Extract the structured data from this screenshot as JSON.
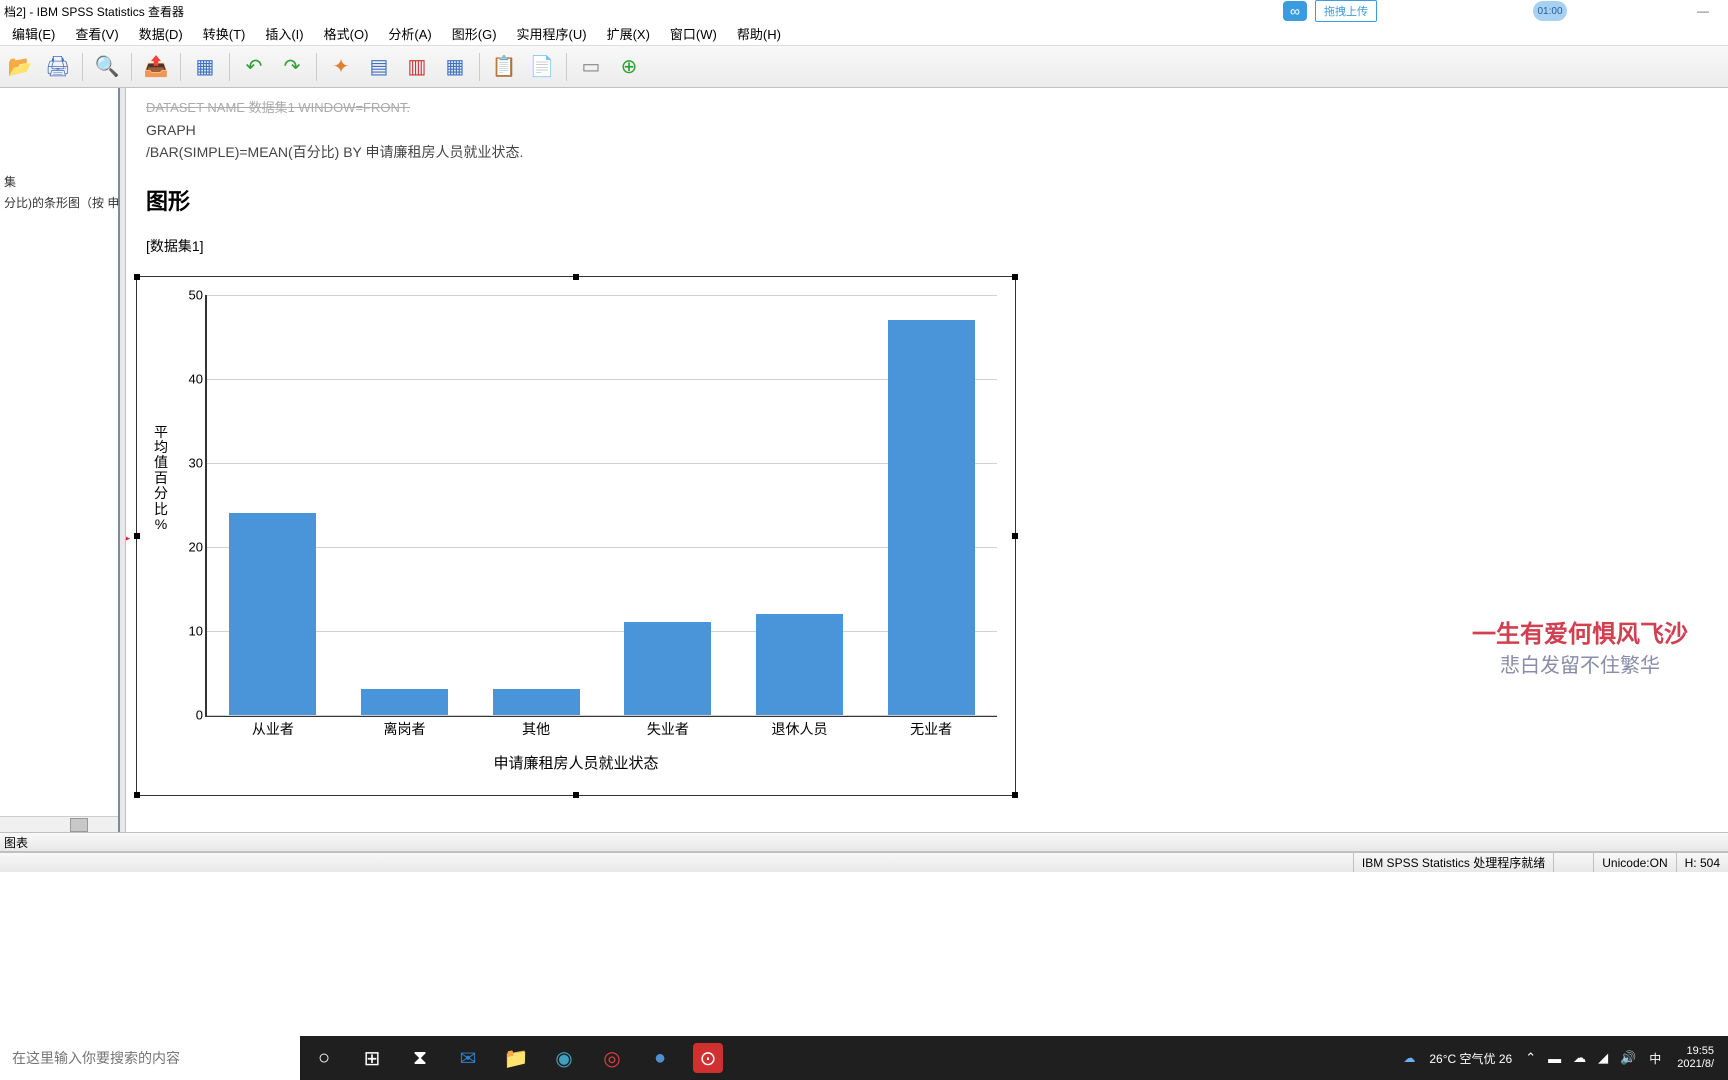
{
  "title": "档2] - IBM SPSS Statistics 查看器",
  "upload_label": "拖拽上传",
  "timer": "01:00",
  "menus": {
    "edit": "编辑(E)",
    "view": "查看(V)",
    "data": "数据(D)",
    "transform": "转换(T)",
    "insert": "插入(I)",
    "format": "格式(O)",
    "analyze": "分析(A)",
    "graph": "图形(G)",
    "utilities": "实用程序(U)",
    "extensions": "扩展(X)",
    "window": "窗口(W)",
    "help": "帮助(H)"
  },
  "outline": {
    "item1": "集",
    "item2": "分比)的条形图（按 申请"
  },
  "syntax": {
    "line0": "DATASET NAME 数据集1 WINDOW=FRONT.",
    "line1": "GRAPH",
    "line2": "  /BAR(SIMPLE)=MEAN(百分比) BY 申请廉租房人员就业状态."
  },
  "section_title": "图形",
  "dataset_label": "[数据集1]",
  "outline_bar_label": "图表",
  "status": {
    "processor": "IBM SPSS Statistics 处理程序就绪",
    "unicode": "Unicode:ON",
    "height": "H: 504"
  },
  "taskbar": {
    "search_placeholder": "在这里输入你要搜索的内容",
    "weather": "26°C 空气优 26",
    "ime": "中",
    "time": "19:55",
    "date": "2021/8/"
  },
  "overlay": {
    "line1": "一生有爱何惧风飞沙",
    "line2": "悲白发留不住繁华"
  },
  "chart_data": {
    "type": "bar",
    "categories": [
      "从业者",
      "离岗者",
      "其他",
      "失业者",
      "退休人员",
      "无业者"
    ],
    "values": [
      24,
      3,
      3,
      11,
      12,
      47
    ],
    "xlabel": "申请廉租房人员就业状态",
    "ylabel": "平均值百分比%",
    "ylim": [
      0,
      50
    ],
    "yticks": [
      0,
      10,
      20,
      30,
      40,
      50
    ]
  }
}
